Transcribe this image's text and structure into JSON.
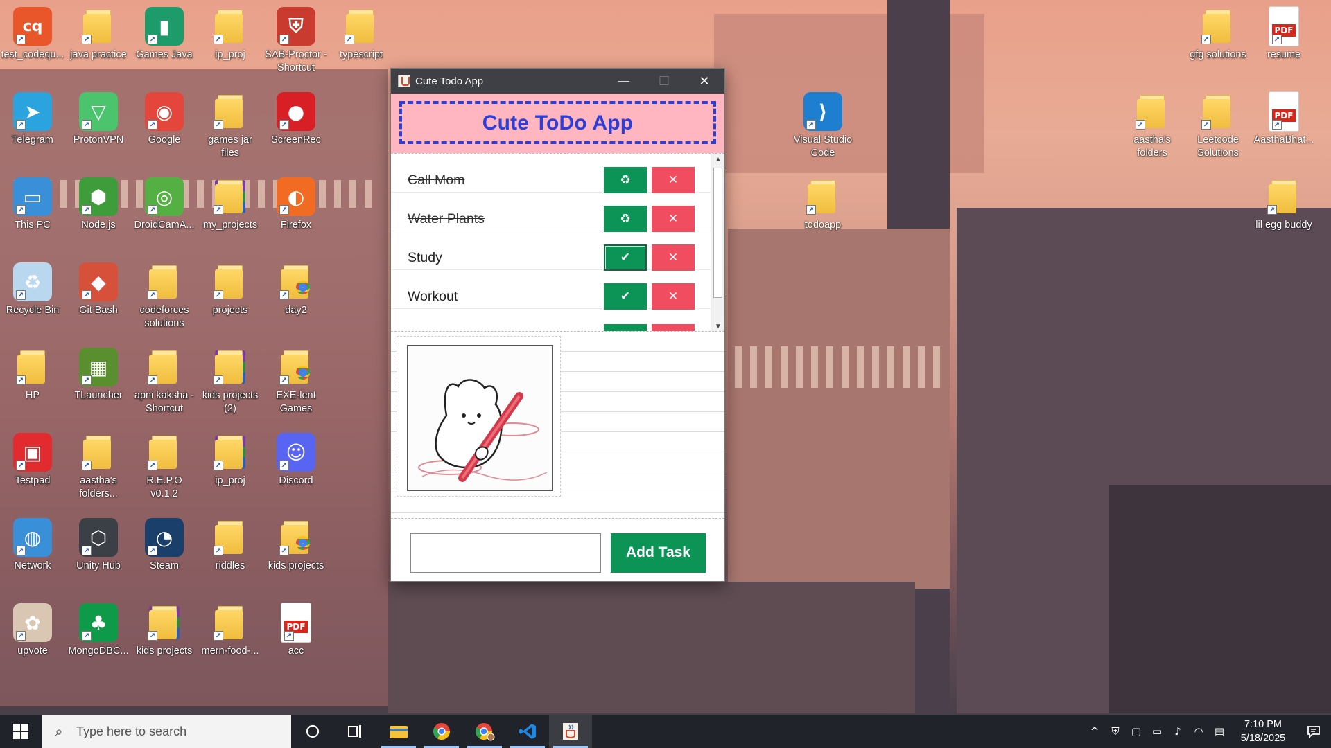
{
  "desktop": {
    "icons": [
      {
        "label": "test_codequ...",
        "kind": "app",
        "color": "#e8562a",
        "glyph": "cq"
      },
      {
        "label": "java practice",
        "kind": "folder"
      },
      {
        "label": "Games Java",
        "kind": "app",
        "color": "#1d9b6b",
        "glyph": "▮"
      },
      {
        "label": "ip_proj",
        "kind": "folder"
      },
      {
        "label": "SAB-Proctor - Shortcut",
        "kind": "app",
        "color": "#c93b2f",
        "glyph": "⛨"
      },
      {
        "label": "typescript",
        "kind": "folder"
      },
      {
        "label": "Telegram",
        "kind": "app",
        "color": "#2aa3df",
        "glyph": "➤"
      },
      {
        "label": "ProtonVPN",
        "kind": "app",
        "color": "#4cc46e",
        "glyph": "▽"
      },
      {
        "label": "Google",
        "kind": "app",
        "color": "#e5463b",
        "glyph": "◉"
      },
      {
        "label": "games jar files",
        "kind": "folder"
      },
      {
        "label": "ScreenRec",
        "kind": "app",
        "color": "#d81f26",
        "glyph": "●"
      },
      {
        "label": "This PC",
        "kind": "app",
        "color": "#3a8fd9",
        "glyph": "▭"
      },
      {
        "label": "Node.js",
        "kind": "app",
        "color": "#3e9c3a",
        "glyph": "⬢"
      },
      {
        "label": "DroidCamA...",
        "kind": "app",
        "color": "#55b043",
        "glyph": "◎"
      },
      {
        "label": "my_projects",
        "kind": "archive"
      },
      {
        "label": "Firefox",
        "kind": "app",
        "color": "#f26b22",
        "glyph": "◐"
      },
      {
        "label": "Recycle Bin",
        "kind": "app",
        "color": "#b9d7ee",
        "glyph": "♻"
      },
      {
        "label": "Git Bash",
        "kind": "app",
        "color": "#d6503a",
        "glyph": "◆"
      },
      {
        "label": "codeforces solutions",
        "kind": "folder"
      },
      {
        "label": "projects",
        "kind": "folder"
      },
      {
        "label": "day2",
        "kind": "chromefolder"
      },
      {
        "label": "HP",
        "kind": "folder"
      },
      {
        "label": "TLauncher",
        "kind": "app",
        "color": "#5a8f2f",
        "glyph": "▦"
      },
      {
        "label": "apni kaksha - Shortcut",
        "kind": "folder"
      },
      {
        "label": "kids projects (2)",
        "kind": "archive"
      },
      {
        "label": "EXE-lent Games",
        "kind": "chromefolder"
      },
      {
        "label": "Testpad",
        "kind": "app",
        "color": "#e12b2f",
        "glyph": "▣"
      },
      {
        "label": "aastha's folders...",
        "kind": "folder"
      },
      {
        "label": "R.E.P.O v0.1.2",
        "kind": "folder"
      },
      {
        "label": "ip_proj",
        "kind": "archive"
      },
      {
        "label": "Discord",
        "kind": "app",
        "color": "#5865f2",
        "glyph": "☺"
      },
      {
        "label": "Network",
        "kind": "app",
        "color": "#3a8fd9",
        "glyph": "◍"
      },
      {
        "label": "Unity Hub",
        "kind": "app",
        "color": "#3b3f46",
        "glyph": "⬡"
      },
      {
        "label": "Steam",
        "kind": "app",
        "color": "#1b3f6b",
        "glyph": "◔"
      },
      {
        "label": "riddles",
        "kind": "folder"
      },
      {
        "label": "kids projects",
        "kind": "chromefolder"
      },
      {
        "label": "upvote",
        "kind": "app",
        "color": "#d9c7b4",
        "glyph": "✿"
      },
      {
        "label": "MongoDBC...",
        "kind": "app",
        "color": "#0f9a4a",
        "glyph": "♣"
      },
      {
        "label": "kids projects",
        "kind": "archive"
      },
      {
        "label": "mern-food-...",
        "kind": "folder"
      },
      {
        "label": "acc",
        "kind": "pdf"
      }
    ],
    "right_icons": [
      {
        "label": "gfg solutions",
        "kind": "folder"
      },
      {
        "label": "resume",
        "kind": "pdf"
      },
      {
        "label": "Visual Studio Code",
        "kind": "app",
        "color": "#1e7fd0",
        "glyph": "⟩"
      },
      {
        "label": "aastha's folders",
        "kind": "folder"
      },
      {
        "label": "Leetcode Solutions",
        "kind": "folder"
      },
      {
        "label": "AasthaBhat...",
        "kind": "pdf"
      },
      {
        "label": "todoapp",
        "kind": "folder"
      },
      {
        "label": "lil egg buddy",
        "kind": "folder"
      }
    ]
  },
  "app": {
    "window_title": "Cute Todo App",
    "minimize": "—",
    "maximize": "☐",
    "close": "✕",
    "header_title": "Cute ToDo App",
    "tasks": [
      {
        "text": "Call Mom",
        "done": true,
        "toggle_icon": "♻",
        "delete_icon": "✕"
      },
      {
        "text": "Water Plants",
        "done": true,
        "toggle_icon": "♻",
        "delete_icon": "✕"
      },
      {
        "text": "Study",
        "done": false,
        "toggle_icon": "✔",
        "delete_icon": "✕"
      },
      {
        "text": "Workout",
        "done": false,
        "toggle_icon": "✔",
        "delete_icon": "✕"
      }
    ],
    "scroll_up": "▲",
    "scroll_down": "▼",
    "input_value": "",
    "add_button_label": "Add Task",
    "accent_green": "#0b9456",
    "accent_red": "#f04e60",
    "header_pink": "#ffb6c1",
    "header_blue": "#2c3fd8"
  },
  "taskbar": {
    "search_placeholder": "Type here to search",
    "time": "7:10 PM",
    "date": "5/18/2025",
    "tray_icons": [
      "chevron-up-icon",
      "security-icon",
      "webcam-icon",
      "battery-icon",
      "volume-icon",
      "wifi-icon",
      "keyboard-icon"
    ],
    "tray_glyphs": [
      "^",
      "⛨",
      "▢",
      "▭",
      "♪",
      "◠",
      "▤"
    ]
  }
}
